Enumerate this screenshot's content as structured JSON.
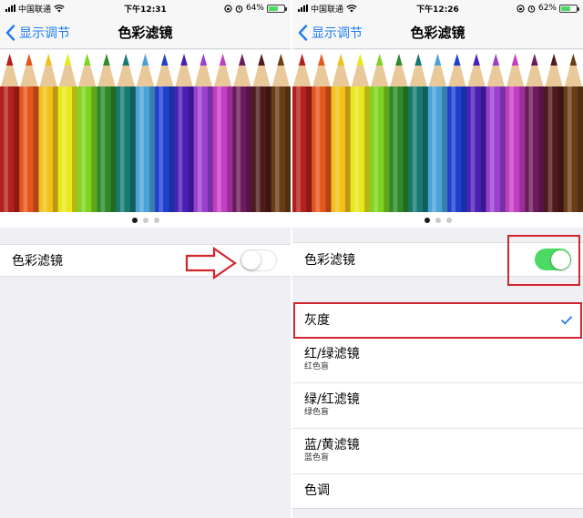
{
  "left_screen": {
    "status": {
      "carrier": "中国联通",
      "time": "下午12:31",
      "battery": "64%",
      "battery_level": 0.64
    },
    "nav": {
      "back_label": "显示调节",
      "title": "色彩滤镜"
    },
    "toggle_row": {
      "label": "色彩滤镜",
      "enabled": false
    }
  },
  "right_screen": {
    "status": {
      "carrier": "中国联通",
      "time": "下午12:26",
      "battery": "62%",
      "battery_level": 0.62
    },
    "nav": {
      "back_label": "显示调节",
      "title": "色彩滤镜"
    },
    "toggle_row": {
      "label": "色彩滤镜",
      "enabled": true
    },
    "filters": [
      {
        "title": "灰度",
        "subtitle": "",
        "selected": true
      },
      {
        "title": "红/绿滤镜",
        "subtitle": "红色盲",
        "selected": false
      },
      {
        "title": "绿/红滤镜",
        "subtitle": "绿色盲",
        "selected": false
      },
      {
        "title": "蓝/黄滤镜",
        "subtitle": "蓝色盲",
        "selected": false
      },
      {
        "title": "色调",
        "subtitle": "",
        "selected": false
      }
    ]
  },
  "page_indicator": {
    "count": 3,
    "active_index": 0
  },
  "pencil_colors": [
    "#b3201d",
    "#e3561c",
    "#f2c21a",
    "#e8e81c",
    "#7fd321",
    "#2e8a2a",
    "#167a72",
    "#4aa3d8",
    "#1f3fcf",
    "#4a1fb5",
    "#9a3fd0",
    "#c43ec2",
    "#6c1a5a",
    "#4e1a1a",
    "#6a3d16"
  ],
  "colors": {
    "accent": "#1f7cf2",
    "switch_on": "#4cd964",
    "annotation": "#d2262f"
  },
  "icons": [
    "signal-icon",
    "wifi-icon",
    "alarm-icon",
    "lock-rotation-icon",
    "battery-icon",
    "back-chevron-icon",
    "checkmark-icon",
    "annotation-arrow"
  ]
}
